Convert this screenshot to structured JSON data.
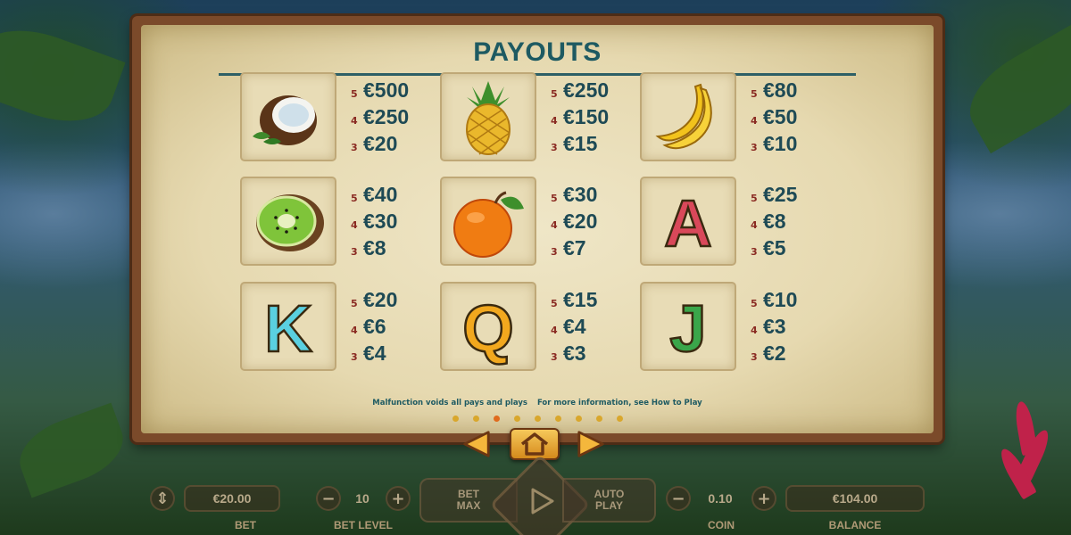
{
  "title": "PAYOUTS",
  "symbols": [
    {
      "icon": "coconut-icon",
      "pays": [
        {
          "n": "5",
          "v": "€500"
        },
        {
          "n": "4",
          "v": "€250"
        },
        {
          "n": "3",
          "v": "€20"
        }
      ]
    },
    {
      "icon": "pineapple-icon",
      "pays": [
        {
          "n": "5",
          "v": "€250"
        },
        {
          "n": "4",
          "v": "€150"
        },
        {
          "n": "3",
          "v": "€15"
        }
      ]
    },
    {
      "icon": "banana-icon",
      "pays": [
        {
          "n": "5",
          "v": "€80"
        },
        {
          "n": "4",
          "v": "€50"
        },
        {
          "n": "3",
          "v": "€10"
        }
      ]
    },
    {
      "icon": "kiwi-icon",
      "pays": [
        {
          "n": "5",
          "v": "€40"
        },
        {
          "n": "4",
          "v": "€30"
        },
        {
          "n": "3",
          "v": "€8"
        }
      ]
    },
    {
      "icon": "orange-icon",
      "pays": [
        {
          "n": "5",
          "v": "€30"
        },
        {
          "n": "4",
          "v": "€20"
        },
        {
          "n": "3",
          "v": "€7"
        }
      ]
    },
    {
      "icon": "letter-a-icon",
      "letter": "A",
      "color": "#d9485a",
      "pays": [
        {
          "n": "5",
          "v": "€25"
        },
        {
          "n": "4",
          "v": "€8"
        },
        {
          "n": "3",
          "v": "€5"
        }
      ]
    },
    {
      "icon": "letter-k-icon",
      "letter": "K",
      "color": "#5ad0e0",
      "pays": [
        {
          "n": "5",
          "v": "€20"
        },
        {
          "n": "4",
          "v": "€6"
        },
        {
          "n": "3",
          "v": "€4"
        }
      ]
    },
    {
      "icon": "letter-q-icon",
      "letter": "Q",
      "color": "#f2a81e",
      "pays": [
        {
          "n": "5",
          "v": "€15"
        },
        {
          "n": "4",
          "v": "€4"
        },
        {
          "n": "3",
          "v": "€3"
        }
      ]
    },
    {
      "icon": "letter-j-icon",
      "letter": "J",
      "color": "#3aa64a",
      "pays": [
        {
          "n": "5",
          "v": "€10"
        },
        {
          "n": "4",
          "v": "€3"
        },
        {
          "n": "3",
          "v": "€2"
        }
      ]
    }
  ],
  "footer": {
    "malfunction": "Malfunction voids all pays and plays",
    "more_info": "For more information, see How to Play"
  },
  "pagination": {
    "total": 9,
    "active": 3
  },
  "nav": {
    "prev_icon": "arrow-left-icon",
    "home_icon": "home-icon",
    "next_icon": "arrow-right-icon"
  },
  "controls": {
    "bet_value": "€20.00",
    "bet_label": "BET",
    "bet_level_value": "10",
    "bet_level_label": "BET LEVEL",
    "bet_max": "BET\nMAX",
    "auto_play": "AUTO\nPLAY",
    "coin_value": "0.10",
    "coin_label": "COIN",
    "balance_value": "€104.00",
    "balance_label": "BALANCE",
    "minus": "−",
    "plus": "+"
  }
}
